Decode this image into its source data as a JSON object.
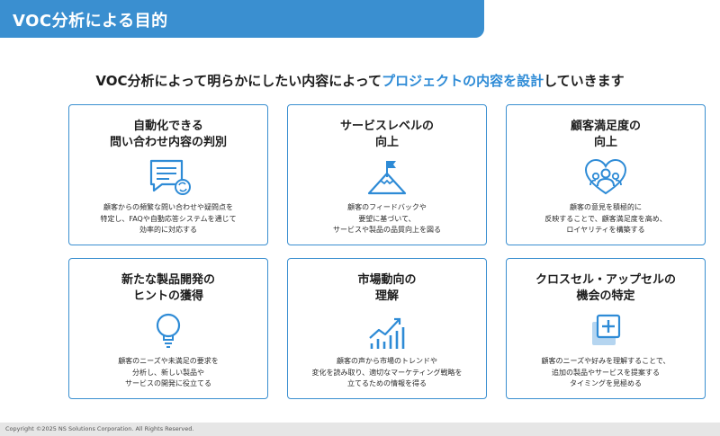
{
  "header": {
    "title": "VOC分析による目的"
  },
  "intro": {
    "before": "VOC分析によって明らかにしたい内容によって",
    "highlight": "プロジェクトの内容を設計",
    "after": "していきます"
  },
  "accent_color": "#2e8bd6",
  "cards": [
    {
      "title": "自動化できる\n問い合わせ内容の判別",
      "icon": "chat-document-icon",
      "description": "顧客からの頻繁な問い合わせや疑問点を\n特定し、FAQや自動応答システムを通じて\n効率的に対応する"
    },
    {
      "title": "サービスレベルの\n向上",
      "icon": "mountain-flag-icon",
      "description": "顧客のフィードバックや\n要望に基づいて、\nサービスや製品の品質向上を図る"
    },
    {
      "title": "顧客満足度の\n向上",
      "icon": "people-heart-icon",
      "description": "顧客の意見を積極的に\n反映することで、顧客満足度を高め、\nロイヤリティを構築する"
    },
    {
      "title": "新たな製品開発の\nヒントの獲得",
      "icon": "lightbulb-icon",
      "description": "顧客のニーズや未満足の要求を\n分析し、新しい製品や\nサービスの開発に役立てる"
    },
    {
      "title": "市場動向の\n理解",
      "icon": "trend-chart-icon",
      "description": "顧客の声から市場のトレンドや\n変化を読み取り、適切なマーケティング戦略を\n立てるための情報を得る"
    },
    {
      "title": "クロスセル・アップセルの\n機会の特定",
      "icon": "plus-squares-icon",
      "description": "顧客のニーズや好みを理解することで、\n追加の製品やサービスを提案する\nタイミングを見極める"
    }
  ],
  "footer": {
    "copyright": "Copyright ©2025 NS Solutions Corporation. All Rights Reserved."
  }
}
